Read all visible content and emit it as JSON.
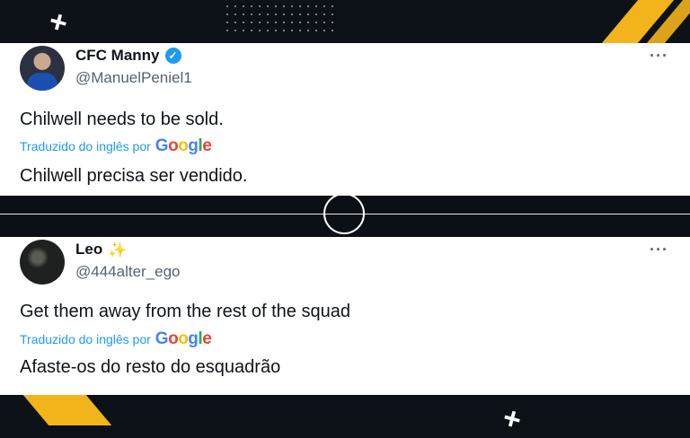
{
  "tweets": [
    {
      "name": "CFC Manny",
      "handle": "@ManuelPeniel1",
      "verified_icon": "verified-badge-icon",
      "original_text": "Chilwell needs to be sold.",
      "translated_label": "Traduzido do inglês por",
      "translated_text": "Chilwell precisa ser vendido.",
      "more_label": "···"
    },
    {
      "name": "Leo",
      "name_emoji": "✨",
      "handle": "@444alter_ego",
      "original_text": "Get them away from the rest of the squad",
      "translated_label": "Traduzido do inglês por",
      "translated_text": "Afaste-os do resto do esquadrão",
      "more_label": "···"
    }
  ],
  "google_logo": {
    "letters": [
      "G",
      "o",
      "o",
      "g",
      "l",
      "e"
    ]
  },
  "colors": {
    "accent_blue": "#1d9bf0",
    "background_dark": "#0b1116",
    "stripe_yellow": "#f3b31a"
  }
}
